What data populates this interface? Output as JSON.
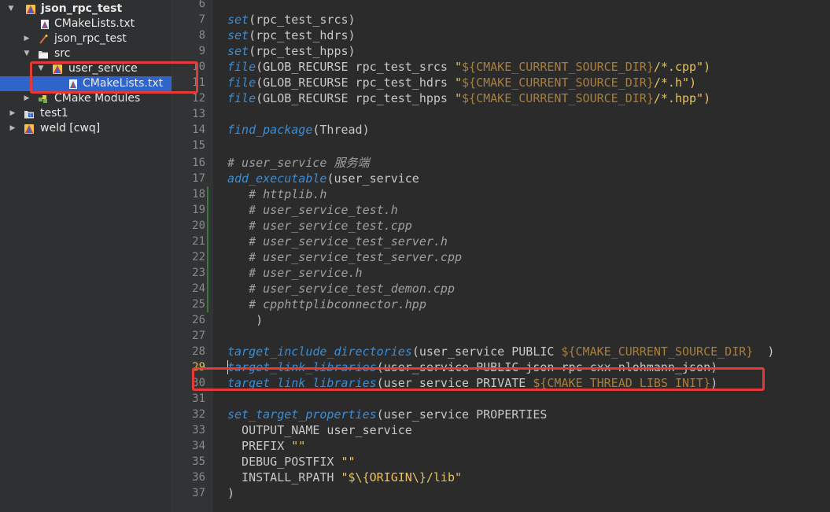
{
  "project_tree": {
    "items": [
      {
        "label": "json_rpc_test",
        "expanded": true,
        "icon": "cmake-project-icon",
        "bold": true
      },
      {
        "label": "CMakeLists.txt",
        "icon": "cmake-file-icon"
      },
      {
        "label": "json_rpc_test",
        "expanded": false,
        "icon": "executable-target-icon"
      },
      {
        "label": "src",
        "expanded": true,
        "icon": "folder-icon"
      },
      {
        "label": "user_service",
        "expanded": true,
        "icon": "cmake-subproject-icon"
      },
      {
        "label": "CMakeLists.txt",
        "icon": "cmake-file-icon",
        "selected": true
      },
      {
        "label": "CMake Modules",
        "expanded": false,
        "icon": "cmake-modules-icon"
      },
      {
        "label": "test1",
        "expanded": false,
        "icon": "project-icon"
      },
      {
        "label": "weld [cwq]",
        "expanded": false,
        "icon": "cmake-project-icon"
      }
    ]
  },
  "editor": {
    "current_line": "29",
    "lines": [
      {
        "n": "6",
        "segs": []
      },
      {
        "n": "7",
        "segs": [
          {
            "t": "set",
            "c": "fn"
          },
          {
            "t": "(rpc_test_srcs)"
          }
        ]
      },
      {
        "n": "8",
        "segs": [
          {
            "t": "set",
            "c": "fn"
          },
          {
            "t": "(rpc_test_hdrs)"
          }
        ]
      },
      {
        "n": "9",
        "segs": [
          {
            "t": "set",
            "c": "fn"
          },
          {
            "t": "(rpc_test_hpps)"
          }
        ]
      },
      {
        "n": "10",
        "segs": [
          {
            "t": "file",
            "c": "fn"
          },
          {
            "t": "(GLOB_RECURSE rpc_test_srcs "
          },
          {
            "t": "\"",
            "c": "str"
          },
          {
            "t": "${CMAKE_CURRENT_SOURCE_DIR}",
            "c": "var"
          },
          {
            "t": "/*.cpp\")",
            "c": "str"
          }
        ]
      },
      {
        "n": "11",
        "segs": [
          {
            "t": "file",
            "c": "fn"
          },
          {
            "t": "(GLOB_RECURSE rpc_test_hdrs "
          },
          {
            "t": "\"",
            "c": "str"
          },
          {
            "t": "${CMAKE_CURRENT_SOURCE_DIR}",
            "c": "var"
          },
          {
            "t": "/*.h\")",
            "c": "str"
          }
        ]
      },
      {
        "n": "12",
        "segs": [
          {
            "t": "file",
            "c": "fn"
          },
          {
            "t": "(GLOB_RECURSE rpc_test_hpps "
          },
          {
            "t": "\"",
            "c": "str"
          },
          {
            "t": "${CMAKE_CURRENT_SOURCE_DIR}",
            "c": "var"
          },
          {
            "t": "/*.hpp\")",
            "c": "str"
          }
        ]
      },
      {
        "n": "13",
        "segs": []
      },
      {
        "n": "14",
        "segs": [
          {
            "t": "find_package",
            "c": "fn"
          },
          {
            "t": "(Thread)"
          }
        ]
      },
      {
        "n": "15",
        "segs": []
      },
      {
        "n": "16",
        "segs": [
          {
            "t": "# user_service 服务端",
            "c": "cmt"
          }
        ]
      },
      {
        "n": "17",
        "segs": [
          {
            "t": "add_executable",
            "c": "fn"
          },
          {
            "t": "(user_service"
          }
        ]
      },
      {
        "n": "18",
        "segs": [
          {
            "t": "   "
          },
          {
            "t": "# httplib.h",
            "c": "cmt"
          }
        ]
      },
      {
        "n": "19",
        "segs": [
          {
            "t": "   "
          },
          {
            "t": "# user_service_test.h",
            "c": "cmt"
          }
        ]
      },
      {
        "n": "20",
        "segs": [
          {
            "t": "   "
          },
          {
            "t": "# user_service_test.cpp",
            "c": "cmt"
          }
        ]
      },
      {
        "n": "21",
        "segs": [
          {
            "t": "   "
          },
          {
            "t": "# user_service_test_server.h",
            "c": "cmt"
          }
        ]
      },
      {
        "n": "22",
        "segs": [
          {
            "t": "   "
          },
          {
            "t": "# user_service_test_server.cpp",
            "c": "cmt"
          }
        ]
      },
      {
        "n": "23",
        "segs": [
          {
            "t": "   "
          },
          {
            "t": "# user_service.h",
            "c": "cmt"
          }
        ]
      },
      {
        "n": "24",
        "segs": [
          {
            "t": "   "
          },
          {
            "t": "# user_service_test_demon.cpp",
            "c": "cmt"
          }
        ]
      },
      {
        "n": "25",
        "segs": [
          {
            "t": "   "
          },
          {
            "t": "# cpphttplibconnector.hpp",
            "c": "cmt"
          }
        ]
      },
      {
        "n": "26",
        "segs": [
          {
            "t": "    )"
          }
        ]
      },
      {
        "n": "27",
        "segs": []
      },
      {
        "n": "28",
        "segs": [
          {
            "t": "target_include_directories",
            "c": "fn"
          },
          {
            "t": "(user_service PUBLIC "
          },
          {
            "t": "${CMAKE_CURRENT_SOURCE_DIR}",
            "c": "var"
          },
          {
            "t": "  )"
          }
        ]
      },
      {
        "n": "29",
        "segs": [
          {
            "t": "target_link_libraries",
            "c": "fn"
          },
          {
            "t": "(user_service PUBLIC json-rpc-cxx nlohmann_json)"
          }
        ]
      },
      {
        "n": "30",
        "segs": [
          {
            "t": "target_link_libraries",
            "c": "fn"
          },
          {
            "t": "(user_service PRIVATE "
          },
          {
            "t": "${CMAKE_THREAD_LIBS_INIT}",
            "c": "var"
          },
          {
            "t": ")"
          }
        ]
      },
      {
        "n": "31",
        "segs": []
      },
      {
        "n": "32",
        "segs": [
          {
            "t": "set_target_properties",
            "c": "fn"
          },
          {
            "t": "(user_service PROPERTIES"
          }
        ]
      },
      {
        "n": "33",
        "segs": [
          {
            "t": "  OUTPUT_NAME user_service"
          }
        ]
      },
      {
        "n": "34",
        "segs": [
          {
            "t": "  PREFIX "
          },
          {
            "t": "\"\"",
            "c": "str"
          }
        ]
      },
      {
        "n": "35",
        "segs": [
          {
            "t": "  DEBUG_POSTFIX "
          },
          {
            "t": "\"\"",
            "c": "str"
          }
        ]
      },
      {
        "n": "36",
        "segs": [
          {
            "t": "  INSTALL_RPATH "
          },
          {
            "t": "\"$\\{ORIGIN\\}/lib\"",
            "c": "str"
          }
        ]
      },
      {
        "n": "37",
        "segs": [
          {
            "t": ")"
          }
        ]
      }
    ]
  },
  "colors": {
    "annotation_red": "#e43b36",
    "selection_blue": "#2f65ca",
    "keyword_blue": "#3a8dd8",
    "string_yellow": "#e8c35c",
    "variable_brown": "#a77e3e"
  }
}
